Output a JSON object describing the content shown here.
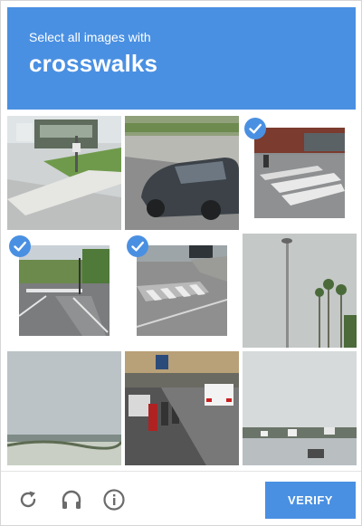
{
  "header": {
    "instruction": "Select all images with",
    "target": "crosswalks"
  },
  "grid": {
    "tiles": [
      {
        "row": 1,
        "col": 1,
        "selected": false
      },
      {
        "row": 1,
        "col": 2,
        "selected": false
      },
      {
        "row": 1,
        "col": 3,
        "selected": true
      },
      {
        "row": 2,
        "col": 1,
        "selected": true
      },
      {
        "row": 2,
        "col": 2,
        "selected": true
      },
      {
        "row": 2,
        "col": 3,
        "selected": false
      },
      {
        "row": 3,
        "col": 1,
        "selected": false
      },
      {
        "row": 3,
        "col": 2,
        "selected": false
      },
      {
        "row": 3,
        "col": 3,
        "selected": false
      }
    ]
  },
  "footer": {
    "icons": [
      "reload-icon",
      "audio-headphones-icon",
      "info-icon"
    ],
    "verify_label": "VERIFY"
  },
  "colors": {
    "accent": "#4a90e2",
    "border": "#d6d6d6"
  }
}
